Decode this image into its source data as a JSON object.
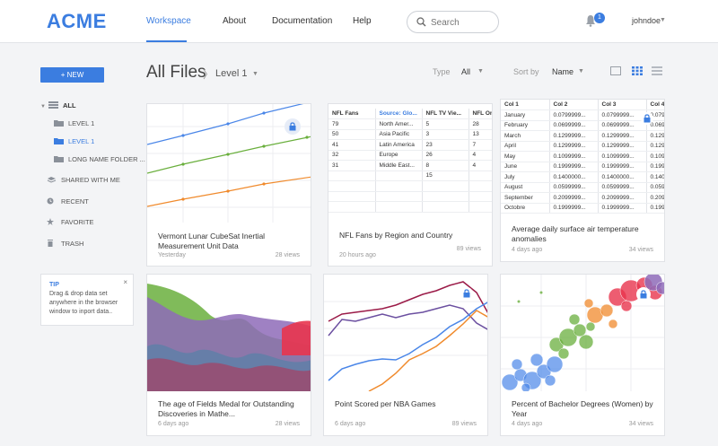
{
  "header": {
    "logo": "ACME",
    "nav": [
      "Workspace",
      "About",
      "Documentation",
      "Help"
    ],
    "search_placeholder": "Search",
    "notifications_count": "1",
    "username": "johndoe"
  },
  "sidebar": {
    "new_label": "+ NEW",
    "items": [
      {
        "label": "ALL"
      },
      {
        "label": "LEVEL 1"
      },
      {
        "label": "LEVEL 1"
      },
      {
        "label": "LONG NAME FOLDER ..."
      },
      {
        "label": "SHARED WITH ME"
      },
      {
        "label": "RECENT"
      },
      {
        "label": "FAVORITE"
      },
      {
        "label": "TRASH"
      }
    ],
    "tip": {
      "title": "TIP",
      "text": "Drag & drop  data set anywhere in the browser window to inport data..",
      "close": "×"
    }
  },
  "toolbar": {
    "title": "All Files",
    "breadcrumb_sep": "〉",
    "breadcrumb_level": "Level 1",
    "type_label": "Type",
    "type_value": "All",
    "sort_label": "Sort by",
    "sort_value": "Name"
  },
  "cards": [
    {
      "title": "Vermont Lunar CubeSat Inertial Measurement Unit Data",
      "time": "Yesterday",
      "views": "28 views"
    },
    {
      "title": "NFL Fans by Region and Country",
      "time": "20 hours ago",
      "views": "89 views"
    },
    {
      "title": "Average daily surface air temperature anomalies",
      "time": "4 days ago",
      "views": "34 views"
    },
    {
      "title": "The age of Fields Medal for Outstanding Discoveries in Mathe...",
      "time": "6 days ago",
      "views": "28 views"
    },
    {
      "title": "Point Scored per NBA Games",
      "time": "6 days ago",
      "views": "89 views"
    },
    {
      "title": "Percent of Bachelor Degrees (Women) by Year",
      "time": "4 days ago",
      "views": "34 views"
    }
  ],
  "nfl_table": {
    "headers": [
      "NFL Fans",
      "Source: Glo...",
      "NFL TV Vie...",
      "NFL On"
    ],
    "rows": [
      [
        "79",
        "North Amer...",
        "5",
        "28"
      ],
      [
        "50",
        "Asia Pacific",
        "3",
        "13"
      ],
      [
        "41",
        "Latin America",
        "23",
        "7"
      ],
      [
        "32",
        "Europe",
        "26",
        "4"
      ],
      [
        "31",
        "Middle East...",
        "8",
        "4"
      ],
      [
        "",
        "",
        "15",
        ""
      ]
    ]
  },
  "temp_table": {
    "headers": [
      "Col 1",
      "Col 2",
      "Col 3",
      "Col 4"
    ],
    "rows": [
      [
        "January",
        "0.0799999...",
        "0.0799999...",
        "0.0799"
      ],
      [
        "February",
        "0.0699999...",
        "0.0699999...",
        "0.0699"
      ],
      [
        "March",
        "0.1299999...",
        "0.1299999...",
        "0.1299"
      ],
      [
        "April",
        "0.1299999...",
        "0.1299999...",
        "0.1299"
      ],
      [
        "May",
        "0.1099999...",
        "0.1099999...",
        "0.1099"
      ],
      [
        "June",
        "0.1999999...",
        "0.1999999...",
        "0.1999"
      ],
      [
        "July",
        "0.1400000...",
        "0.1400000...",
        "0.1400"
      ],
      [
        "August",
        "0.0599999...",
        "0.0599999...",
        "0.0599"
      ],
      [
        "September",
        "0.2099999...",
        "0.2099999...",
        "0.2099"
      ],
      [
        "Octobre",
        "0.1999999...",
        "0.1999999...",
        "0.1999"
      ]
    ]
  },
  "colors": {
    "accent": "#3b7de0",
    "blue": "#4a86e8",
    "green": "#6aaf3d",
    "orange": "#f08a2c",
    "red": "#e8344e",
    "purple": "#8e6bb8",
    "maroon": "#9b1b48"
  }
}
